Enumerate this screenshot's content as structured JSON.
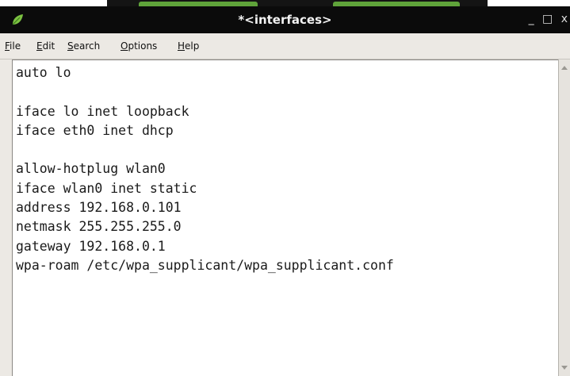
{
  "window": {
    "title": "*<interfaces>",
    "controls": "_ □ x",
    "app_icon": "leafpad-leaf-icon",
    "colors": {
      "titlebar_bg": "#0b0b0b",
      "title_text": "#f2f2f2",
      "menubar_bg": "#ece9e4",
      "editor_bg": "#ffffff"
    }
  },
  "menu": {
    "items": [
      {
        "mnemonic": "F",
        "rest": "ile"
      },
      {
        "mnemonic": "E",
        "rest": "dit"
      },
      {
        "mnemonic": "S",
        "rest": "earch"
      },
      {
        "mnemonic": "O",
        "rest": "ptions"
      },
      {
        "mnemonic": "H",
        "rest": "elp"
      }
    ]
  },
  "editor": {
    "content": "auto lo\n\niface lo inet loopback\niface eth0 inet dhcp\n\nallow-hotplug wlan0\niface wlan0 inet static\naddress 192.168.0.101\nnetmask 255.255.255.0\ngateway 192.168.0.1\nwpa-roam /etc/wpa_supplicant/wpa_supplicant.conf"
  }
}
